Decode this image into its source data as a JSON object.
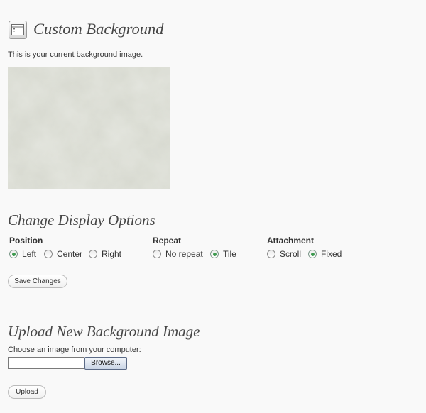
{
  "header": {
    "icon": "appearance-icon",
    "title": "Custom Background"
  },
  "current_background": {
    "intro": "This is your current background image."
  },
  "display_options": {
    "title": "Change Display Options",
    "position": {
      "label": "Position",
      "options": [
        "Left",
        "Center",
        "Right"
      ],
      "selected": "Left"
    },
    "repeat": {
      "label": "Repeat",
      "options": [
        "No repeat",
        "Tile"
      ],
      "selected": "Tile"
    },
    "attachment": {
      "label": "Attachment",
      "options": [
        "Scroll",
        "Fixed"
      ],
      "selected": "Fixed"
    },
    "save_label": "Save Changes"
  },
  "upload": {
    "title": "Upload New Background Image",
    "choose_text": "Choose an image from your computer:",
    "file_value": "",
    "browse_label": "Browse...",
    "upload_label": "Upload"
  },
  "colors": {
    "background": "#f9f9f9",
    "radio_selected": "#3d9a4f",
    "heading": "#464646"
  }
}
